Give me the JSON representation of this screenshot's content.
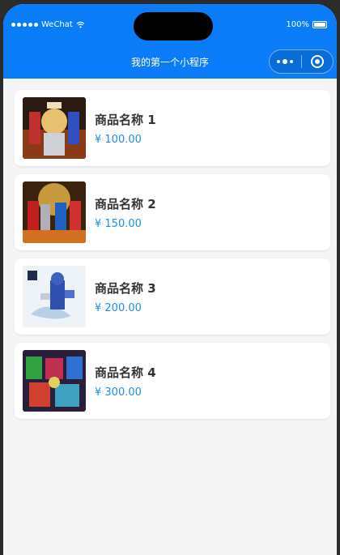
{
  "status_bar": {
    "carrier": "WeChat",
    "battery": "100%"
  },
  "nav": {
    "title": "我的第一个小程序"
  },
  "products": [
    {
      "name": "商品名称 1",
      "price": "¥ 100.00"
    },
    {
      "name": "商品名称 2",
      "price": "¥ 150.00"
    },
    {
      "name": "商品名称 3",
      "price": "¥ 200.00"
    },
    {
      "name": "商品名称 4",
      "price": "¥ 300.00"
    }
  ],
  "colors": {
    "brand_blue": "#0a7cf7",
    "price_blue": "#1a8cf0",
    "page_bg": "#f5f5f5"
  },
  "icons": [
    "signal-dots-icon",
    "wifi-icon",
    "battery-icon",
    "more-dots-icon",
    "target-icon"
  ]
}
